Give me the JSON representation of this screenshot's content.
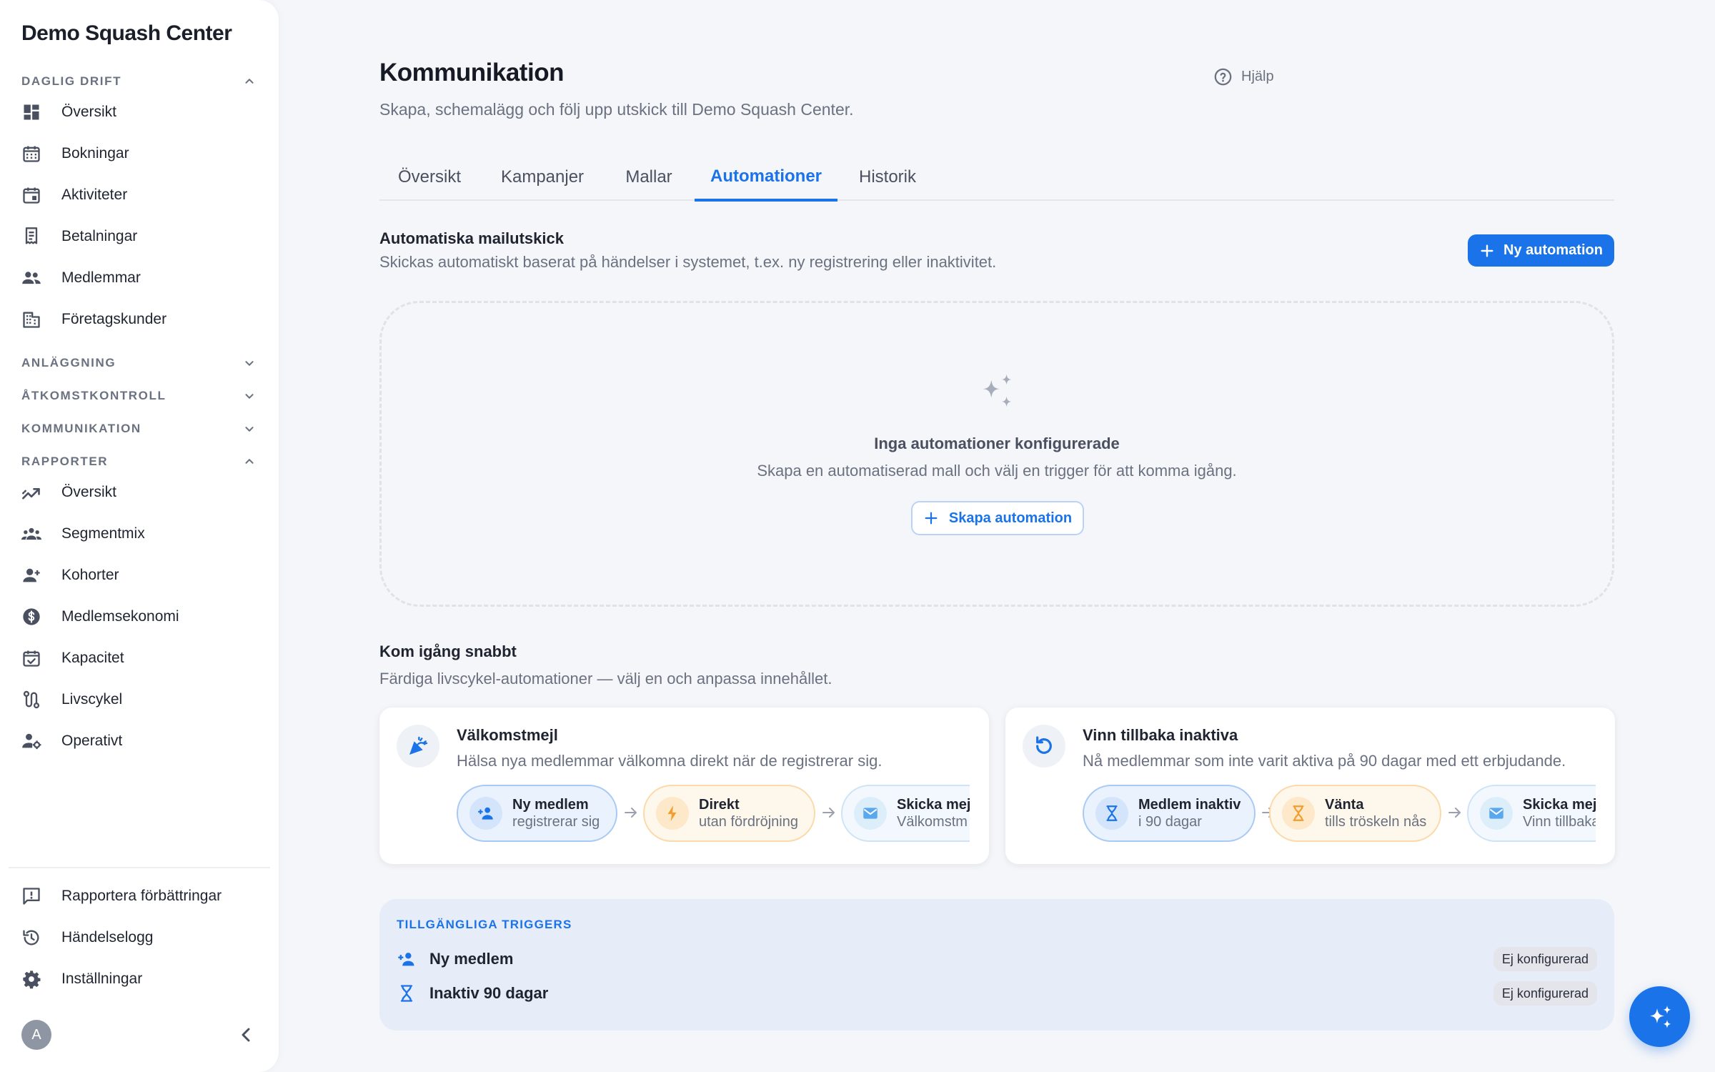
{
  "brand": "Demo Squash Center",
  "sidebar": {
    "sections": [
      {
        "label": "DAGLIG DRIFT"
      },
      {
        "label": "ANLÄGGNING"
      },
      {
        "label": "ÅTKOMSTKONTROLL"
      },
      {
        "label": "KOMMUNIKATION"
      },
      {
        "label": "RAPPORTER"
      }
    ],
    "daily": [
      {
        "label": "Översikt",
        "icon": "dashboard-icon"
      },
      {
        "label": "Bokningar",
        "icon": "calendar-grid-icon"
      },
      {
        "label": "Aktiviteter",
        "icon": "event-icon"
      },
      {
        "label": "Betalningar",
        "icon": "receipt-icon"
      },
      {
        "label": "Medlemmar",
        "icon": "people-icon"
      },
      {
        "label": "Företagskunder",
        "icon": "building-icon"
      }
    ],
    "reports": [
      {
        "label": "Översikt",
        "icon": "trend-icon"
      },
      {
        "label": "Segmentmix",
        "icon": "groups-icon"
      },
      {
        "label": "Kohorter",
        "icon": "person-add-icon"
      },
      {
        "label": "Medlemsekonomi",
        "icon": "dollar-icon"
      },
      {
        "label": "Kapacitet",
        "icon": "calendar-check-icon"
      },
      {
        "label": "Livscykel",
        "icon": "route-icon"
      },
      {
        "label": "Operativt",
        "icon": "person-gear-icon"
      }
    ],
    "bottom": [
      {
        "label": "Rapportera förbättringar",
        "icon": "feedback-icon"
      },
      {
        "label": "Händelselogg",
        "icon": "history-icon"
      },
      {
        "label": "Inställningar",
        "icon": "gear-icon"
      }
    ],
    "avatar": "A"
  },
  "header": {
    "title": "Kommunikation",
    "subtitle": "Skapa, schemalägg och följ upp utskick till Demo Squash Center.",
    "help": "Hjälp"
  },
  "tabs": [
    {
      "label": "Översikt"
    },
    {
      "label": "Kampanjer"
    },
    {
      "label": "Mallar"
    },
    {
      "label": "Automationer"
    },
    {
      "label": "Historik"
    }
  ],
  "automations": {
    "title": "Automatiska mailutskick",
    "subtitle": "Skickas automatiskt baserat på händelser i systemet, t.ex. ny registrering eller inaktivitet.",
    "new_button": "Ny automation",
    "empty_title": "Inga automationer konfigurerade",
    "empty_sub": "Skapa en automatiserad mall och välj en trigger för att komma igång.",
    "create_button": "Skapa automation"
  },
  "quickstart": {
    "title": "Kom igång snabbt",
    "subtitle": "Färdiga livscykel-automationer — välj en och anpassa innehållet.",
    "cards": [
      {
        "title": "Välkomstmejl",
        "desc": "Hälsa nya medlemmar välkomna direkt när de registrerar sig.",
        "steps": [
          {
            "title": "Ny medlem",
            "sub": "registrerar sig"
          },
          {
            "title": "Direkt",
            "sub": "utan fördröjning"
          },
          {
            "title": "Skicka mejl",
            "sub": "Välkomstm"
          }
        ]
      },
      {
        "title": "Vinn tillbaka inaktiva",
        "desc": "Nå medlemmar som inte varit aktiva på 90 dagar med ett erbjudande.",
        "steps": [
          {
            "title": "Medlem inaktiv",
            "sub": "i 90 dagar"
          },
          {
            "title": "Vänta",
            "sub": "tills tröskeln nås"
          },
          {
            "title": "Skicka mejl",
            "sub": "Vinn tillbaka"
          }
        ]
      }
    ]
  },
  "triggers": {
    "heading": "TILLGÄNGLIGA TRIGGERS",
    "items": [
      {
        "label": "Ny medlem",
        "status": "Ej konfigurerad"
      },
      {
        "label": "Inaktiv 90 dagar",
        "status": "Ej konfigurerad"
      }
    ]
  },
  "colors": {
    "accent": "#1a73e8",
    "text": "#1f2430",
    "muted": "#6a7180",
    "warning": "#f29d2e"
  }
}
